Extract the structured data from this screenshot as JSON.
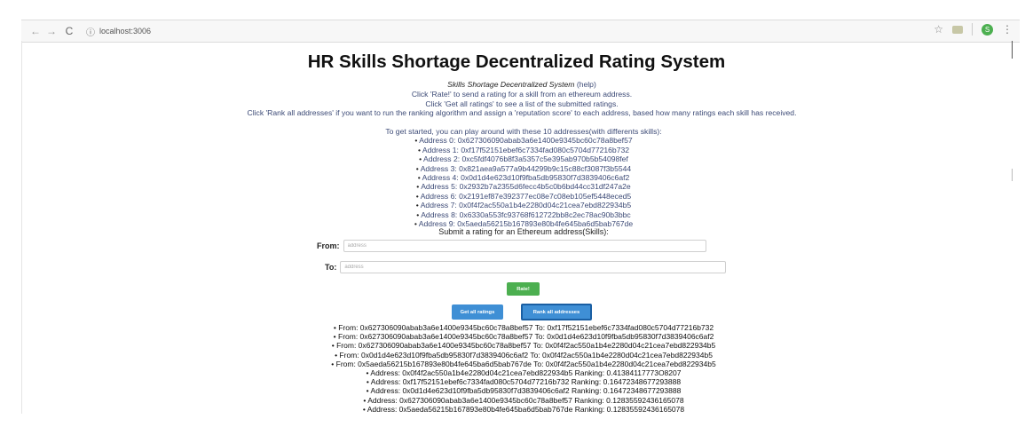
{
  "browser": {
    "url": "localhost:3006",
    "back_glyph": "←",
    "forward_glyph": "→",
    "reload_glyph": "C",
    "info_glyph": "ⓘ",
    "star_glyph": "☆",
    "profile_initial": "S",
    "menu_glyph": "⋮"
  },
  "page": {
    "title": "HR Skills Shortage Decentralized Rating System",
    "subtitle": "Skills Shortage Decentralized System",
    "help_link": "(help)",
    "instructions": [
      "Click 'Rate!' to send a rating for a skill from an ethereum address.",
      "Click 'Get all ratings' to see a list of the submitted ratings.",
      "Click 'Rank all addresses' if you want to run the ranking algorithm and assign a 'reputation score' to each address, based how many ratings each skill has received."
    ],
    "get_started": "To get started, you can play around with these 10 addresses(with differents skills):",
    "addresses": [
      "Address 0: 0x627306090abab3a6e1400e9345bc60c78a8bef57",
      "Address 1: 0xf17f52151ebef6c7334fad080c5704d77216b732",
      "Address 2: 0xc5fdf4076b8f3a5357c5e395ab970b5b54098fef",
      "Address 3: 0x821aea9a577a9b44299b9c15c88cf3087f3b5544",
      "Address 4: 0x0d1d4e623d10f9fba5db95830f7d3839406c6af2",
      "Address 5: 0x2932b7a2355d6fecc4b5c0b6bd44cc31df247a2e",
      "Address 6: 0x2191ef87e392377ec08e7c08eb105ef5448eced5",
      "Address 7: 0x0f4f2ac550a1b4e2280d04c21cea7ebd822934b5",
      "Address 8: 0x6330a553fc93768f612722bb8c2ec78ac90b3bbc",
      "Address 9: 0x5aeda56215b167893e80b4fe645ba6d5bab767de"
    ],
    "submit_heading": "Submit a rating for an Ethereum address(Skills):"
  },
  "form": {
    "from_label": "From:",
    "from_placeholder": "address",
    "to_label": "To:",
    "to_placeholder": "address",
    "rate_button": "Rate!",
    "get_all_button": "Get all ratings",
    "rank_all_button": "Rank all addresses"
  },
  "ratings": [
    "From: 0x627306090abab3a6e1400e9345bc60c78a8bef57 To: 0xf17f52151ebef6c7334fad080c5704d77216b732",
    "From: 0x627306090abab3a6e1400e9345bc60c78a8bef57 To: 0x0d1d4e623d10f9fba5db95830f7d3839406c6af2",
    "From: 0x627306090abab3a6e1400e9345bc60c78a8bef57 To: 0x0f4f2ac550a1b4e2280d04c21cea7ebd822934b5",
    "From: 0x0d1d4e623d10f9fba5db95830f7d3839406c6af2 To: 0x0f4f2ac550a1b4e2280d04c21cea7ebd822934b5",
    "From: 0x5aeda56215b167893e80b4fe645ba6d5bab767de To: 0x0f4f2ac550a1b4e2280d04c21cea7ebd822934b5"
  ],
  "rankings": [
    "Address: 0x0f4f2ac550a1b4e2280d04c21cea7ebd822934b5 Ranking: 0.41384117773O8207",
    "Address: 0xf17f52151ebef6c7334fad080c5704d77216b732 Ranking: 0.16472348677293888",
    "Address: 0x0d1d4e623d10f9fba5db95830f7d3839406c6af2 Ranking: 0.16472348677293888",
    "Address: 0x627306090abab3a6e1400e9345bc60c78a8bef57 Ranking: 0.12835592436165078",
    "Address: 0x5aeda56215b167893e80b4fe645ba6d5bab767de Ranking: 0.12835592436165078"
  ]
}
